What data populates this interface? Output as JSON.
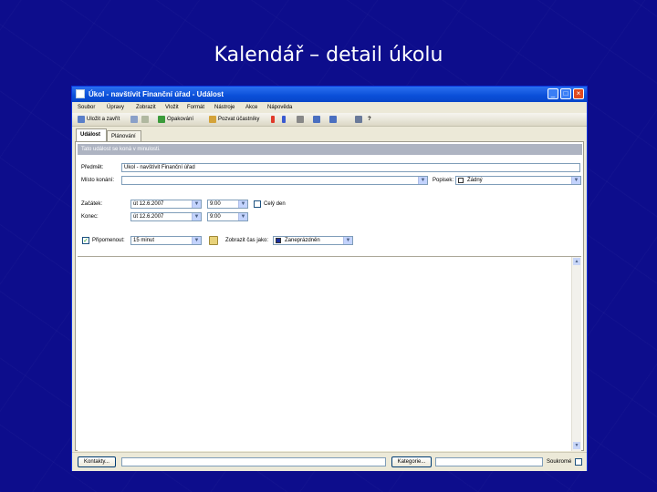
{
  "slide": {
    "title": "Kalendář – detail úkolu"
  },
  "window": {
    "title": "Úkol - navštívit Finanční úřad - Událost",
    "controls": {
      "minimize": "_",
      "maximize": "□",
      "close": "×"
    }
  },
  "menu": [
    "Soubor",
    "Úpravy",
    "Zobrazit",
    "Vložit",
    "Formát",
    "Nástroje",
    "Akce",
    "Nápověda"
  ],
  "toolbar": {
    "save_close": "Uložit a zavřít",
    "recurrence": "Opakování",
    "invite": "Pozvat účastníky",
    "help": "?"
  },
  "tabs": {
    "event": "Událost",
    "schedule": "Plánování"
  },
  "info_bar": "Tato událost se koná v minulosti.",
  "form": {
    "subject_label": "Předmět:",
    "subject_value": "Úkol - navštívit Finanční úřad",
    "location_label": "Místo konání:",
    "location_value": "",
    "label_label": "Popisek:",
    "label_value": "Žádný",
    "start_label": "Začátek:",
    "start_date": "út 12.6.2007",
    "start_time": "9:00",
    "allday_label": "Celý den",
    "end_label": "Konec:",
    "end_date": "út 12.6.2007",
    "end_time": "9:00",
    "reminder_label": "Připomenout:",
    "reminder_value": "15 minut",
    "showas_label": "Zobrazit čas jako:",
    "showas_value": "Zaneprázdněn"
  },
  "bottom": {
    "contacts_button": "Kontakty...",
    "categories_button": "Kategorie...",
    "private_label": "Soukromé"
  },
  "colors": {
    "accent": "#0a4fd8",
    "background": "#0d0d8c",
    "busy": "#1a2fa0"
  }
}
